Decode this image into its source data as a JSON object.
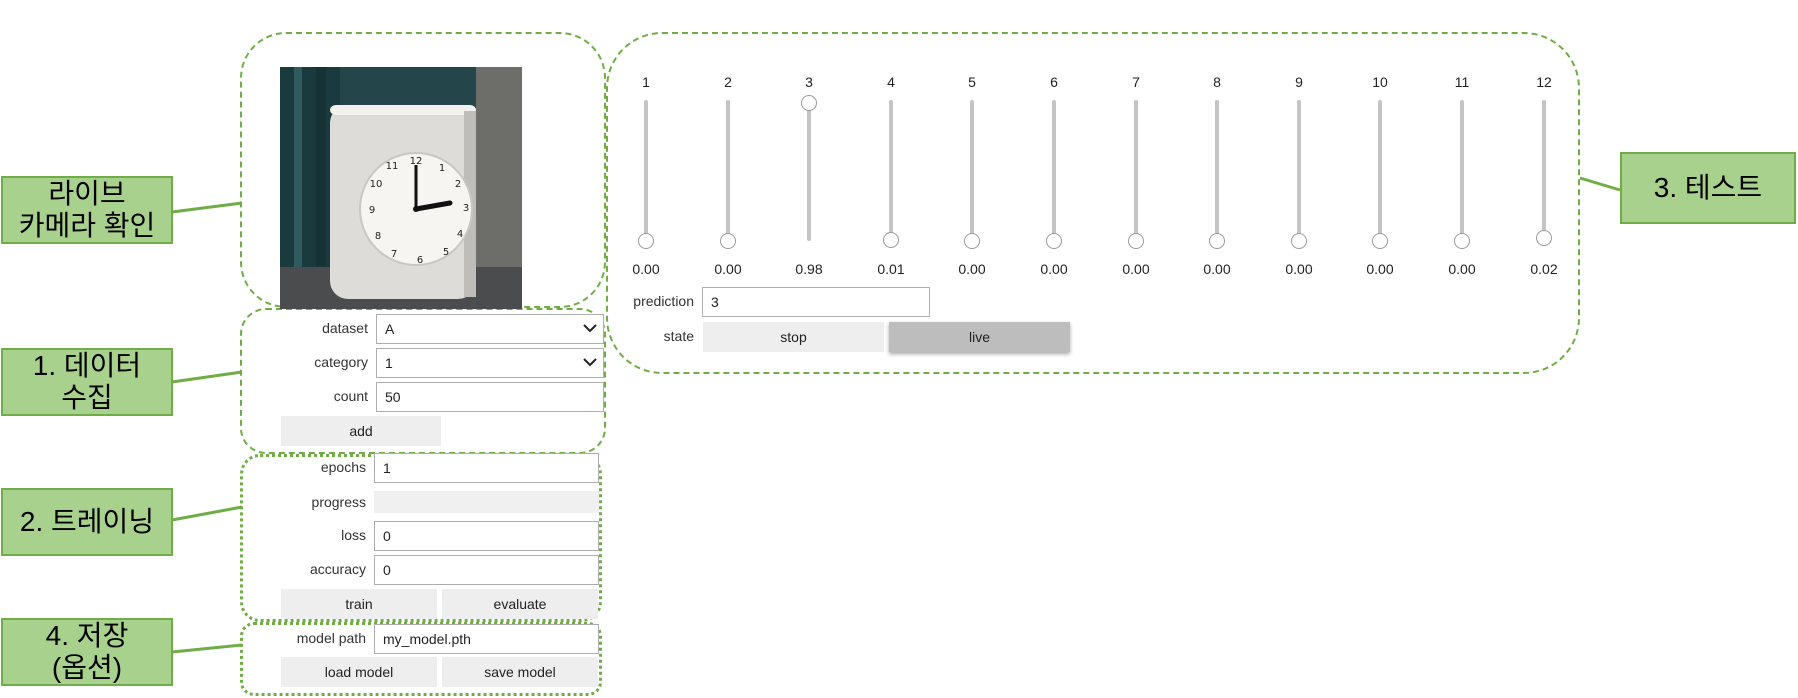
{
  "callouts": {
    "camera": "라이브\n카메라 확인",
    "collect": "1. 데이터\n수집",
    "training": "2. 트레이닝",
    "test": "3. 테스트",
    "save": "4. 저장\n(옵션)"
  },
  "collect": {
    "dataset_label": "dataset",
    "dataset_value": "A",
    "category_label": "category",
    "category_value": "1",
    "count_label": "count",
    "count_value": "50",
    "add_label": "add"
  },
  "training": {
    "epochs_label": "epochs",
    "epochs_value": "1",
    "progress_label": "progress",
    "progress_value": 0,
    "loss_label": "loss",
    "loss_value": "0",
    "accuracy_label": "accuracy",
    "accuracy_value": "0",
    "train_label": "train",
    "evaluate_label": "evaluate"
  },
  "test": {
    "sliders": [
      {
        "label": "1",
        "value": "0.00"
      },
      {
        "label": "2",
        "value": "0.00"
      },
      {
        "label": "3",
        "value": "0.98"
      },
      {
        "label": "4",
        "value": "0.01"
      },
      {
        "label": "5",
        "value": "0.00"
      },
      {
        "label": "6",
        "value": "0.00"
      },
      {
        "label": "7",
        "value": "0.00"
      },
      {
        "label": "8",
        "value": "0.00"
      },
      {
        "label": "9",
        "value": "0.00"
      },
      {
        "label": "10",
        "value": "0.00"
      },
      {
        "label": "11",
        "value": "0.00"
      },
      {
        "label": "12",
        "value": "0.02"
      }
    ],
    "prediction_label": "prediction",
    "prediction_value": "3",
    "state_label": "state",
    "stop_label": "stop",
    "live_label": "live",
    "active_state": "live"
  },
  "save": {
    "model_path_label": "model path",
    "model_path_value": "my_model.pth",
    "load_label": "load model",
    "save_label": "save model"
  },
  "colors": {
    "callout_fill": "#a9d18e",
    "callout_border": "#70ad47",
    "button": "#eeeeee",
    "button_active": "#bdbdbd"
  }
}
